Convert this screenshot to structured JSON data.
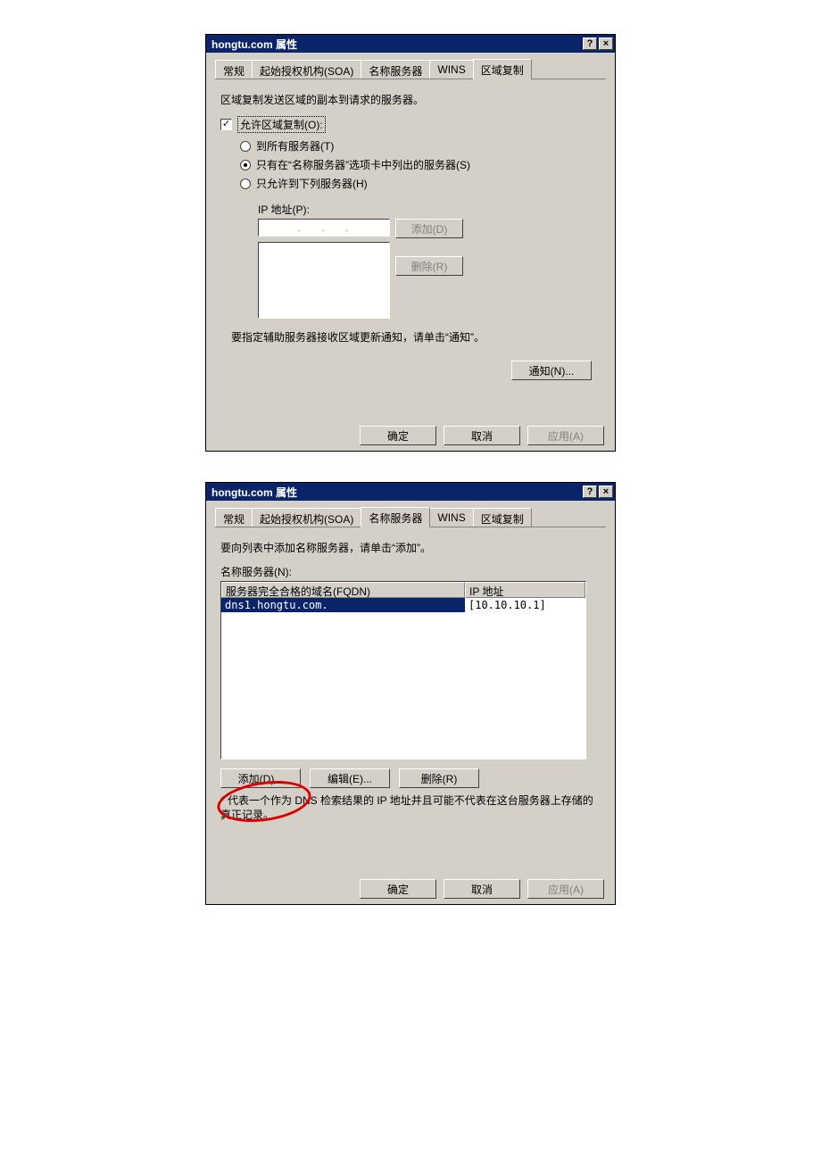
{
  "dialog1": {
    "title": "hongtu.com 属性",
    "tabs": [
      "常规",
      "起始授权机构(SOA)",
      "名称服务器",
      "WINS",
      "区域复制"
    ],
    "active_tab": "区域复制",
    "desc": "区域复制发送区域的副本到请求的服务器。",
    "allow_zone_transfer": "允许区域复制(O):",
    "radio_all": "到所有服务器(T)",
    "radio_ns": "只有在“名称服务器”选项卡中列出的服务器(S)",
    "radio_only": "只允许到下列服务器(H)",
    "ip_label": "IP 地址(P):",
    "ip_dots": ".   .   .",
    "add_btn": "添加(D)",
    "remove_btn": "删除(R)",
    "note": "要指定辅助服务器接收区域更新通知，请单击“通知”。",
    "notify_btn": "通知(N)...",
    "ok": "确定",
    "cancel": "取消",
    "apply": "应用(A)"
  },
  "dialog2": {
    "title": "hongtu.com 属性",
    "tabs": [
      "常规",
      "起始授权机构(SOA)",
      "名称服务器",
      "WINS",
      "区域复制"
    ],
    "active_tab": "名称服务器",
    "desc": "要向列表中添加名称服务器，请单击“添加”。",
    "list_label": "名称服务器(N):",
    "col_fqdn": "服务器完全合格的域名(FQDN)",
    "col_ip": "IP 地址",
    "row_fqdn": "dns1.hongtu.com.",
    "row_ip": "[10.10.10.1]",
    "add_btn": "添加(D)...",
    "edit_btn": "编辑(E)...",
    "remove_btn": "删除(R)",
    "footnote": "* 代表一个作为 DNS 检索结果的 IP 地址并且可能不代表在这台服务器上存储的真正记录。",
    "ok": "确定",
    "cancel": "取消",
    "apply": "应用(A)"
  }
}
